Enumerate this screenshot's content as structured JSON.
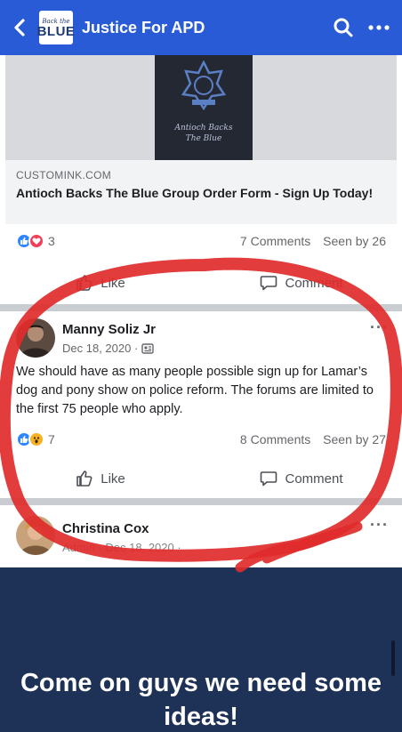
{
  "header": {
    "group_name": "Justice For APD",
    "logo_small": "Back the",
    "logo_big": "BLUE",
    "back_icon": "chevron-left-icon",
    "search_icon": "search-icon",
    "more_icon": "more-horizontal-icon"
  },
  "link_post": {
    "preview_caption_line1": "Antioch Backs",
    "preview_caption_line2": "The Blue",
    "domain": "CUSTOMINK.COM",
    "title": "Antioch Backs The Blue Group Order Form - Sign Up Today!",
    "reaction_count": "3",
    "comments": "7 Comments",
    "seen_by": "Seen by 26",
    "like_label": "Like",
    "comment_label": "Comment"
  },
  "manny_post": {
    "author": "Manny Soliz Jr",
    "date": "Dec 18, 2020 ·",
    "body": "We should have as many people possible sign up for Lamar’s dog and pony show on police reform.  The forums are limited to the first 75 people who apply.",
    "reaction_count": "7",
    "comments": "8 Comments",
    "seen_by": "Seen by 27",
    "like_label": "Like",
    "comment_label": "Comment",
    "more": "···"
  },
  "christina_post": {
    "author": "Christina Cox",
    "meta": "Admin · Dec 18, 2020 ·",
    "more": "···"
  },
  "image_post": {
    "text": "Come on guys we need some ideas!"
  },
  "colors": {
    "header_blue": "#2a5bd7",
    "annotation_red": "#e02b2b",
    "navy": "#1e3257"
  }
}
